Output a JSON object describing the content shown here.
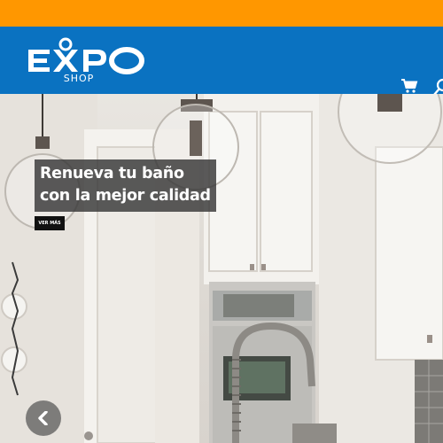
{
  "header": {
    "logo": {
      "text": "EXPO",
      "sub": "SHOP"
    },
    "icons": [
      "cart-icon",
      "search-icon"
    ]
  },
  "colors": {
    "topbar": "#ff9700",
    "header": "#0a72c1",
    "caption_bg": "#373737",
    "button_bg": "#111111"
  },
  "hero": {
    "caption_line1": "Renueva tu baño",
    "caption_line2": "con la mejor calidad",
    "cta_label": "VER MÁS",
    "prev_icon": "chevron-left-icon"
  }
}
